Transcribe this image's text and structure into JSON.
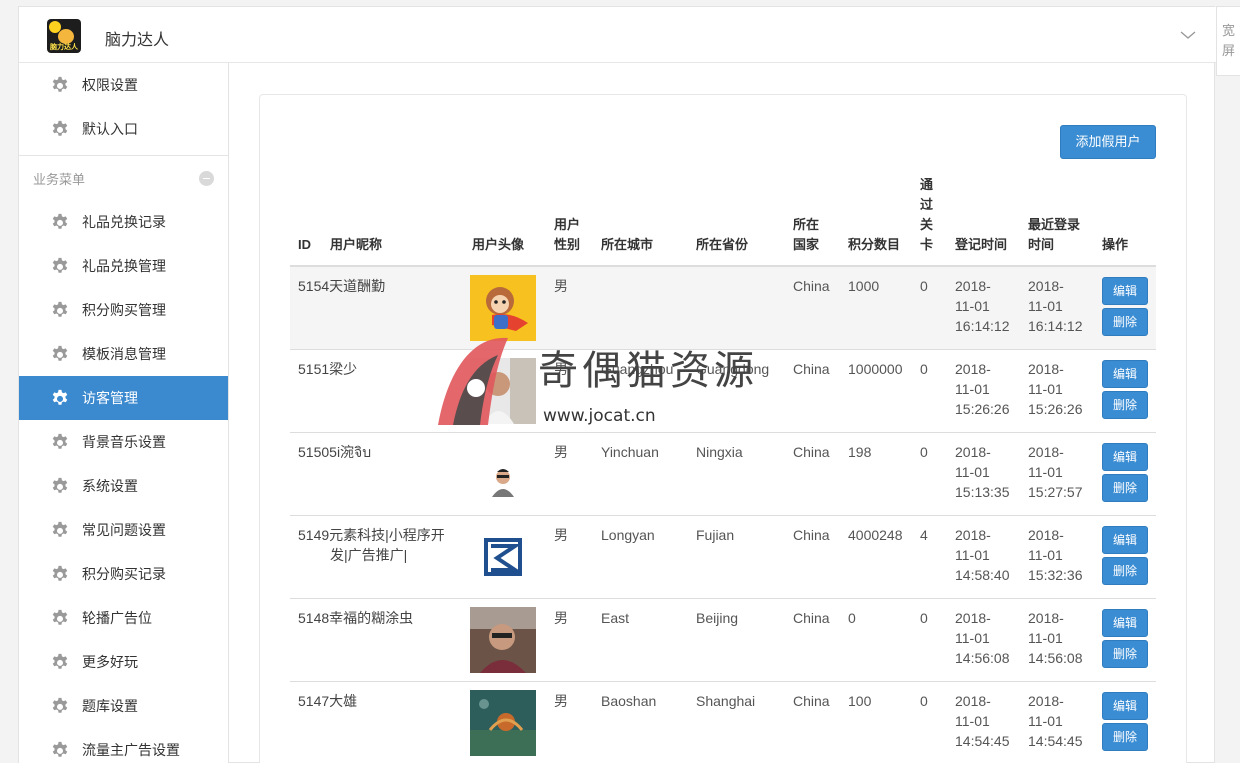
{
  "app": {
    "title": "脑力达人",
    "logo_text": "脑力达人"
  },
  "side_toggle": {
    "label_1": "宽",
    "label_2": "屏"
  },
  "sidebar": {
    "top_items": [
      {
        "label": "权限设置"
      },
      {
        "label": "默认入口"
      }
    ],
    "group_title": "业务菜单",
    "items": [
      {
        "label": "礼品兑换记录"
      },
      {
        "label": "礼品兑换管理"
      },
      {
        "label": "积分购买管理"
      },
      {
        "label": "模板消息管理"
      },
      {
        "label": "访客管理"
      },
      {
        "label": "背景音乐设置"
      },
      {
        "label": "系统设置"
      },
      {
        "label": "常见问题设置"
      },
      {
        "label": "积分购买记录"
      },
      {
        "label": "轮播广告位"
      },
      {
        "label": "更多好玩"
      },
      {
        "label": "题库设置"
      },
      {
        "label": "流量主广告设置"
      }
    ],
    "active": "访客管理"
  },
  "toolbar": {
    "add_label": "添加假用户"
  },
  "table": {
    "headers": {
      "id": "ID",
      "nick": "用户昵称",
      "avatar": "用户头像",
      "gender_1": "用户",
      "gender_2": "性别",
      "city": "所在城市",
      "province": "所在省份",
      "country_1": "所在",
      "country_2": "国家",
      "points": "积分数目",
      "pass_1": "通",
      "pass_2": "过",
      "pass_3": "关",
      "pass_4": "卡",
      "reg_1": "登记时间",
      "last_1": "最近登录",
      "last_2": "时间",
      "ops": "操作"
    },
    "edit_label": "编辑",
    "delete_label": "删除",
    "rows": [
      {
        "id": "5154",
        "nick_1": "天道酬勤",
        "nick_2": "",
        "avatar": "cartoon-monkey",
        "gender": "男",
        "city": "",
        "province": "",
        "country": "China",
        "points": "1000",
        "pass": "0",
        "reg_1": "2018-",
        "reg_2": "11-01",
        "reg_3": "16:14:12",
        "last_1": "2018-",
        "last_2": "11-01",
        "last_3": "16:14:12"
      },
      {
        "id": "5151",
        "nick_1": "梁少",
        "nick_2": "",
        "avatar": "man-photo",
        "gender": "男",
        "city": "Guangzhou",
        "province": "Guangdong",
        "country": "China",
        "points": "1000000",
        "pass": "0",
        "reg_1": "2018-",
        "reg_2": "11-01",
        "reg_3": "15:26:26",
        "last_1": "2018-",
        "last_2": "11-01",
        "last_3": "15:26:26"
      },
      {
        "id": "5150",
        "nick_1": "5i涴จิบ",
        "nick_2": "",
        "avatar": "sunglasses-man",
        "gender": "男",
        "city": "Yinchuan",
        "province": "Ningxia",
        "country": "China",
        "points": "198",
        "pass": "0",
        "reg_1": "2018-",
        "reg_2": "11-01",
        "reg_3": "15:13:35",
        "last_1": "2018-",
        "last_2": "11-01",
        "last_3": "15:27:57"
      },
      {
        "id": "5149",
        "nick_1": "元素科技|小程序开",
        "nick_2": "发|广告推广|",
        "avatar": "blue-logo",
        "gender": "男",
        "city": "Longyan",
        "province": "Fujian",
        "country": "China",
        "points": "4000248",
        "pass": "4",
        "reg_1": "2018-",
        "reg_2": "11-01",
        "reg_3": "14:58:40",
        "last_1": "2018-",
        "last_2": "11-01",
        "last_3": "15:32:36"
      },
      {
        "id": "5148",
        "nick_1": "幸福的糊涂虫",
        "nick_2": "",
        "avatar": "selfie-photo",
        "gender": "男",
        "city": "East",
        "province": "Beijing",
        "country": "China",
        "points": "0",
        "pass": "0",
        "reg_1": "2018-",
        "reg_2": "11-01",
        "reg_3": "14:56:08",
        "last_1": "2018-",
        "last_2": "11-01",
        "last_3": "14:56:08"
      },
      {
        "id": "5147",
        "nick_1": "大雄",
        "nick_2": "",
        "avatar": "nature-photo",
        "gender": "男",
        "city": "Baoshan",
        "province": "Shanghai",
        "country": "China",
        "points": "100",
        "pass": "0",
        "reg_1": "2018-",
        "reg_2": "11-01",
        "reg_3": "14:54:45",
        "last_1": "2018-",
        "last_2": "11-01",
        "last_3": "14:54:45"
      }
    ]
  },
  "watermark": {
    "text": "奇偶猫资源",
    "url": "www.jocat.cn"
  },
  "colors": {
    "accent": "#3b8dd3",
    "active_nav": "#3b89cf",
    "row_highlight": "#f5f5f5"
  }
}
